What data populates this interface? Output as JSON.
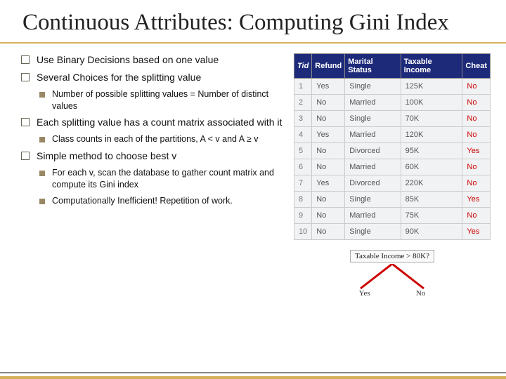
{
  "title": "Continuous Attributes: Computing Gini Index",
  "bullets": {
    "b1": "Use Binary Decisions based on one value",
    "b2": "Several Choices for the splitting value",
    "b2_1": "Number of possible splitting values = Number of distinct values",
    "b3": "Each splitting value has a count matrix associated with it",
    "b3_1": "Class counts in each of the partitions, A < v and A ≥ v",
    "b4": "Simple method to choose best v",
    "b4_1": "For each v, scan the database to gather count matrix and compute its Gini index",
    "b4_2": "Computationally Inefficient! Repetition of work."
  },
  "table": {
    "headers": {
      "tid": "Tid",
      "refund": "Refund",
      "marital": "Marital Status",
      "income": "Taxable Income",
      "cheat": "Cheat"
    },
    "rows": [
      {
        "tid": "1",
        "refund": "Yes",
        "marital": "Single",
        "income": "125K",
        "cheat": "No"
      },
      {
        "tid": "2",
        "refund": "No",
        "marital": "Married",
        "income": "100K",
        "cheat": "No"
      },
      {
        "tid": "3",
        "refund": "No",
        "marital": "Single",
        "income": "70K",
        "cheat": "No"
      },
      {
        "tid": "4",
        "refund": "Yes",
        "marital": "Married",
        "income": "120K",
        "cheat": "No"
      },
      {
        "tid": "5",
        "refund": "No",
        "marital": "Divorced",
        "income": "95K",
        "cheat": "Yes"
      },
      {
        "tid": "6",
        "refund": "No",
        "marital": "Married",
        "income": "60K",
        "cheat": "No"
      },
      {
        "tid": "7",
        "refund": "Yes",
        "marital": "Divorced",
        "income": "220K",
        "cheat": "No"
      },
      {
        "tid": "8",
        "refund": "No",
        "marital": "Single",
        "income": "85K",
        "cheat": "Yes"
      },
      {
        "tid": "9",
        "refund": "No",
        "marital": "Married",
        "income": "75K",
        "cheat": "No"
      },
      {
        "tid": "10",
        "refund": "No",
        "marital": "Single",
        "income": "90K",
        "cheat": "Yes"
      }
    ]
  },
  "tree": {
    "question": "Taxable Income > 80K?",
    "yes": "Yes",
    "no": "No"
  }
}
